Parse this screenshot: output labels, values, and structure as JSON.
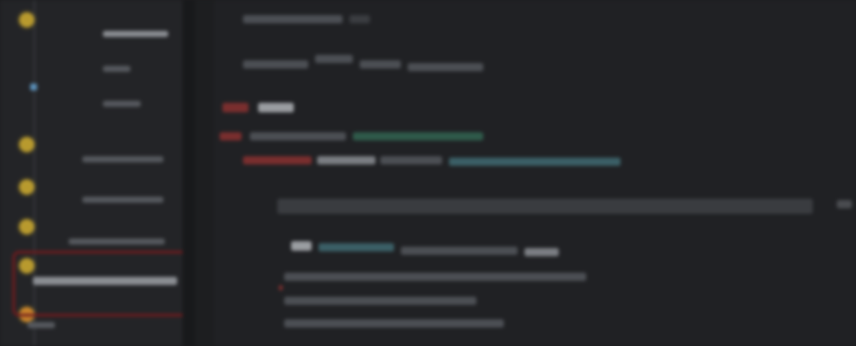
{
  "window": {
    "title": ""
  },
  "tree": {
    "items": [
      {
        "label": ""
      },
      {
        "label": ""
      },
      {
        "label": ""
      },
      {
        "label": ""
      },
      {
        "label": ""
      },
      {
        "label": ""
      },
      {
        "label": ""
      }
    ]
  },
  "editor": {
    "lines": []
  },
  "colors": {
    "highlight_box": "#6e1b1d",
    "folder": "#b89a2e",
    "keyword": "#7a2e2e",
    "string": "#2f5a4a"
  }
}
